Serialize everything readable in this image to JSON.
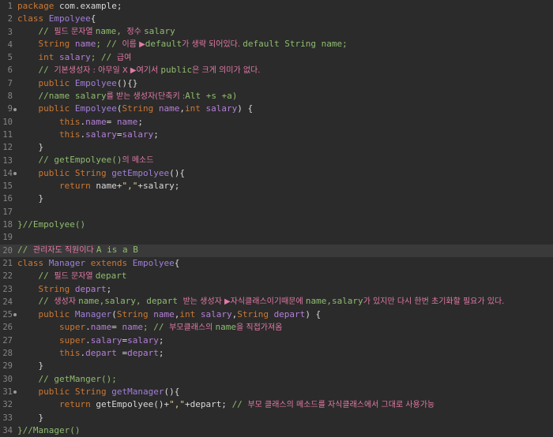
{
  "editor": {
    "lines": [
      {
        "n": "1",
        "tokens": [
          {
            "t": "package ",
            "c": "kw"
          },
          {
            "t": "com.example;",
            "c": "plain"
          }
        ]
      },
      {
        "n": "2",
        "tokens": [
          {
            "t": "class ",
            "c": "kw"
          },
          {
            "t": "Empolyee",
            "c": "cls"
          },
          {
            "t": "{",
            "c": "plain"
          }
        ]
      },
      {
        "n": "3",
        "tokens": [
          {
            "t": "    // ",
            "c": "com"
          },
          {
            "t": "필드 문자열 ",
            "c": "comK"
          },
          {
            "t": "name, ",
            "c": "com"
          },
          {
            "t": "정수 ",
            "c": "comK"
          },
          {
            "t": "salary",
            "c": "com"
          }
        ]
      },
      {
        "n": "4",
        "tokens": [
          {
            "t": "    ",
            "c": "plain"
          },
          {
            "t": "String ",
            "c": "type"
          },
          {
            "t": "name",
            "c": "field"
          },
          {
            "t": "; // ",
            "c": "com"
          },
          {
            "t": "이름 ▶",
            "c": "comK"
          },
          {
            "t": "default",
            "c": "com"
          },
          {
            "t": "가 생략 되어있다. ",
            "c": "comK"
          },
          {
            "t": "default String name;",
            "c": "com"
          }
        ]
      },
      {
        "n": "5",
        "tokens": [
          {
            "t": "    ",
            "c": "plain"
          },
          {
            "t": "int ",
            "c": "kw"
          },
          {
            "t": "salary",
            "c": "field"
          },
          {
            "t": "; // ",
            "c": "com"
          },
          {
            "t": "급여",
            "c": "comK"
          }
        ]
      },
      {
        "n": "6",
        "tokens": [
          {
            "t": "    // ",
            "c": "com"
          },
          {
            "t": "기본생성자 : 아무일 X ▶여기서 ",
            "c": "comK"
          },
          {
            "t": "public",
            "c": "com"
          },
          {
            "t": "은 크게 의미가 없다.",
            "c": "comK"
          }
        ]
      },
      {
        "n": "7",
        "tokens": [
          {
            "t": "    ",
            "c": "plain"
          },
          {
            "t": "public ",
            "c": "kw"
          },
          {
            "t": "Empolyee",
            "c": "cls"
          },
          {
            "t": "(){}",
            "c": "plain"
          }
        ]
      },
      {
        "n": "8",
        "tokens": [
          {
            "t": "    //name salary",
            "c": "com"
          },
          {
            "t": "를 받는 생성자(단축키 :",
            "c": "comK"
          },
          {
            "t": "Alt +s +a)",
            "c": "com"
          }
        ]
      },
      {
        "n": "9",
        "mark": true,
        "tokens": [
          {
            "t": "    ",
            "c": "plain"
          },
          {
            "t": "public ",
            "c": "kw"
          },
          {
            "t": "Empolyee",
            "c": "cls"
          },
          {
            "t": "(",
            "c": "plain"
          },
          {
            "t": "String ",
            "c": "type"
          },
          {
            "t": "name",
            "c": "field"
          },
          {
            "t": ",",
            "c": "plain"
          },
          {
            "t": "int ",
            "c": "kw"
          },
          {
            "t": "salary",
            "c": "field"
          },
          {
            "t": ") {",
            "c": "plain"
          }
        ]
      },
      {
        "n": "10",
        "tokens": [
          {
            "t": "        ",
            "c": "plain"
          },
          {
            "t": "this",
            "c": "kw"
          },
          {
            "t": ".",
            "c": "plain"
          },
          {
            "t": "name",
            "c": "field"
          },
          {
            "t": "= ",
            "c": "plain"
          },
          {
            "t": "name",
            "c": "field"
          },
          {
            "t": ";",
            "c": "plain"
          }
        ]
      },
      {
        "n": "11",
        "tokens": [
          {
            "t": "        ",
            "c": "plain"
          },
          {
            "t": "this",
            "c": "kw"
          },
          {
            "t": ".",
            "c": "plain"
          },
          {
            "t": "salary",
            "c": "field"
          },
          {
            "t": "=",
            "c": "plain"
          },
          {
            "t": "salary",
            "c": "field"
          },
          {
            "t": ";",
            "c": "plain"
          }
        ]
      },
      {
        "n": "12",
        "tokens": [
          {
            "t": "    }",
            "c": "plain"
          }
        ]
      },
      {
        "n": "13",
        "tokens": [
          {
            "t": "    // getEmpolyee()",
            "c": "com"
          },
          {
            "t": "의 메소드",
            "c": "comK"
          }
        ]
      },
      {
        "n": "14",
        "mark": true,
        "tokens": [
          {
            "t": "    ",
            "c": "plain"
          },
          {
            "t": "public ",
            "c": "kw"
          },
          {
            "t": "String ",
            "c": "type"
          },
          {
            "t": "getEmpolyee",
            "c": "cls"
          },
          {
            "t": "(){",
            "c": "plain"
          }
        ]
      },
      {
        "n": "15",
        "tokens": [
          {
            "t": "        ",
            "c": "plain"
          },
          {
            "t": "return ",
            "c": "kw"
          },
          {
            "t": "name+",
            "c": "plain"
          },
          {
            "t": "\",\"",
            "c": "str"
          },
          {
            "t": "+salary;",
            "c": "plain"
          }
        ]
      },
      {
        "n": "16",
        "tokens": [
          {
            "t": "    }",
            "c": "plain"
          }
        ]
      },
      {
        "n": "17",
        "tokens": [
          {
            "t": "",
            "c": "plain"
          }
        ]
      },
      {
        "n": "18",
        "tokens": [
          {
            "t": "}//Empolyee()",
            "c": "com"
          }
        ]
      },
      {
        "n": "19",
        "tokens": [
          {
            "t": "",
            "c": "plain"
          }
        ]
      },
      {
        "n": "20",
        "hl": true,
        "tokens": [
          {
            "t": "// ",
            "c": "com"
          },
          {
            "t": "관리자도 직원이다 ",
            "c": "comK"
          },
          {
            "t": "A is a B",
            "c": "com"
          }
        ]
      },
      {
        "n": "21",
        "tokens": [
          {
            "t": "class ",
            "c": "kw"
          },
          {
            "t": "Manager ",
            "c": "cls"
          },
          {
            "t": "extends ",
            "c": "kw"
          },
          {
            "t": "Empolyee",
            "c": "cls"
          },
          {
            "t": "{",
            "c": "plain"
          }
        ]
      },
      {
        "n": "22",
        "tokens": [
          {
            "t": "    // ",
            "c": "com"
          },
          {
            "t": "필드 문자열 ",
            "c": "comK"
          },
          {
            "t": "depart",
            "c": "com"
          }
        ]
      },
      {
        "n": "23",
        "tokens": [
          {
            "t": "    ",
            "c": "plain"
          },
          {
            "t": "String ",
            "c": "type"
          },
          {
            "t": "depart",
            "c": "field"
          },
          {
            "t": ";",
            "c": "plain"
          }
        ]
      },
      {
        "n": "24",
        "tokens": [
          {
            "t": "    // ",
            "c": "com"
          },
          {
            "t": "생성자 ",
            "c": "comK"
          },
          {
            "t": "name,salary, depart ",
            "c": "com"
          },
          {
            "t": "받는 생성자 ▶자식클래스이기때문에 ",
            "c": "comK"
          },
          {
            "t": "name,salary",
            "c": "com"
          },
          {
            "t": "가 있지만 다시 한번 초기화할 필요가 있다.",
            "c": "comK"
          }
        ]
      },
      {
        "n": "25",
        "mark": true,
        "tokens": [
          {
            "t": "    ",
            "c": "plain"
          },
          {
            "t": "public ",
            "c": "kw"
          },
          {
            "t": "Manager",
            "c": "cls"
          },
          {
            "t": "(",
            "c": "plain"
          },
          {
            "t": "String ",
            "c": "type"
          },
          {
            "t": "name",
            "c": "field"
          },
          {
            "t": ",",
            "c": "plain"
          },
          {
            "t": "int ",
            "c": "kw"
          },
          {
            "t": "salary",
            "c": "field"
          },
          {
            "t": ",",
            "c": "plain"
          },
          {
            "t": "String ",
            "c": "type"
          },
          {
            "t": "depart",
            "c": "field"
          },
          {
            "t": ") {",
            "c": "plain"
          }
        ]
      },
      {
        "n": "26",
        "tokens": [
          {
            "t": "        ",
            "c": "plain"
          },
          {
            "t": "super",
            "c": "kw"
          },
          {
            "t": ".",
            "c": "plain"
          },
          {
            "t": "name",
            "c": "field"
          },
          {
            "t": "= ",
            "c": "plain"
          },
          {
            "t": "name",
            "c": "field"
          },
          {
            "t": "; // ",
            "c": "com"
          },
          {
            "t": "부모클래스의 ",
            "c": "comK"
          },
          {
            "t": "name",
            "c": "com"
          },
          {
            "t": "을 직접가져옴",
            "c": "comK"
          }
        ]
      },
      {
        "n": "27",
        "tokens": [
          {
            "t": "        ",
            "c": "plain"
          },
          {
            "t": "super",
            "c": "kw"
          },
          {
            "t": ".",
            "c": "plain"
          },
          {
            "t": "salary",
            "c": "field"
          },
          {
            "t": "=",
            "c": "plain"
          },
          {
            "t": "salary",
            "c": "field"
          },
          {
            "t": ";",
            "c": "plain"
          }
        ]
      },
      {
        "n": "28",
        "tokens": [
          {
            "t": "        ",
            "c": "plain"
          },
          {
            "t": "this",
            "c": "kw"
          },
          {
            "t": ".",
            "c": "plain"
          },
          {
            "t": "depart ",
            "c": "field"
          },
          {
            "t": "=",
            "c": "plain"
          },
          {
            "t": "depart",
            "c": "field"
          },
          {
            "t": ";",
            "c": "plain"
          }
        ]
      },
      {
        "n": "29",
        "tokens": [
          {
            "t": "    }",
            "c": "plain"
          }
        ]
      },
      {
        "n": "30",
        "tokens": [
          {
            "t": "    // getManger();",
            "c": "com"
          }
        ]
      },
      {
        "n": "31",
        "mark": true,
        "tokens": [
          {
            "t": "    ",
            "c": "plain"
          },
          {
            "t": "public ",
            "c": "kw"
          },
          {
            "t": "String ",
            "c": "type"
          },
          {
            "t": "getManager",
            "c": "cls"
          },
          {
            "t": "(){",
            "c": "plain"
          }
        ]
      },
      {
        "n": "32",
        "tokens": [
          {
            "t": "        ",
            "c": "plain"
          },
          {
            "t": "return ",
            "c": "kw"
          },
          {
            "t": "getEmpolyee",
            "c": "plain"
          },
          {
            "t": "()+",
            "c": "plain"
          },
          {
            "t": "\",\"",
            "c": "str"
          },
          {
            "t": "+depart; ",
            "c": "plain"
          },
          {
            "t": "// ",
            "c": "com"
          },
          {
            "t": "부모 클래스의 메소드를 자식클래스에서 그대로 사용가능",
            "c": "comK"
          }
        ]
      },
      {
        "n": "33",
        "tokens": [
          {
            "t": "    }",
            "c": "plain"
          }
        ]
      },
      {
        "n": "34",
        "tokens": [
          {
            "t": "}//Manager()",
            "c": "com"
          }
        ]
      }
    ]
  },
  "colors": {
    "background": "#2b2b2b",
    "line_highlight": "#3a3a3a",
    "keyword": "#cc7832",
    "class_name": "#a07fd8",
    "field": "#b47fd9",
    "string": "#e3d08a",
    "comment": "#8fbc6f",
    "comment_korean": "#e27aa6"
  }
}
